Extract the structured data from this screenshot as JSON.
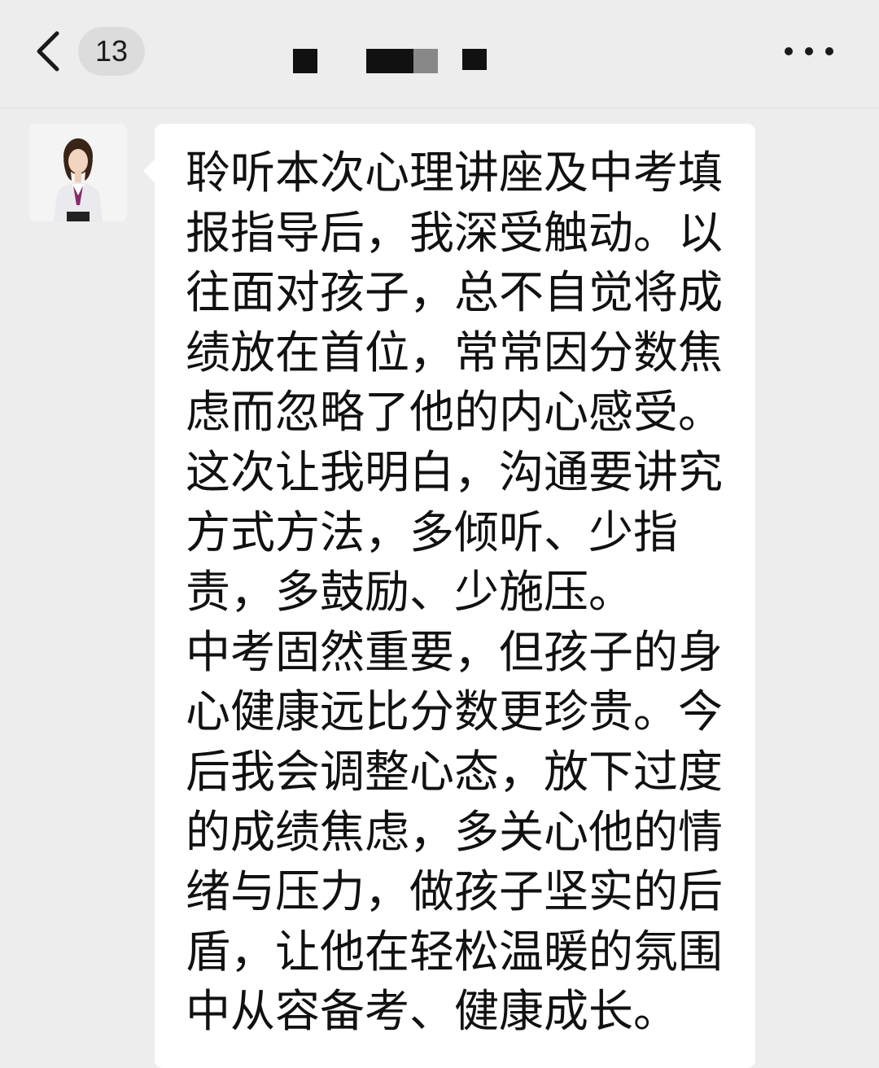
{
  "header": {
    "unread_count": "13",
    "back_icon": "chevron-left-icon",
    "more_icon": "more-dots-icon"
  },
  "message": {
    "avatar_icon": "contact-avatar",
    "text": "聆听本次心理讲座及中考填报指导后，我深受触动。以往面对孩子，总不自觉将成绩放在首位，常常因分数焦虑而忽略了他的内心感受。这次让我明白，沟通要讲究方式方法，多倾听、少指责，多鼓励、少施压。\n中考固然重要，但孩子的身心健康远比分数更珍贵。今后我会调整心态，放下过度的成绩焦虑，多关心他的情绪与压力，做孩子坚实的后盾，让他在轻松温暖的氛围中从容备考、健康成长。"
  },
  "colors": {
    "background": "#ededed",
    "bubble": "#ffffff",
    "text": "#111111"
  }
}
